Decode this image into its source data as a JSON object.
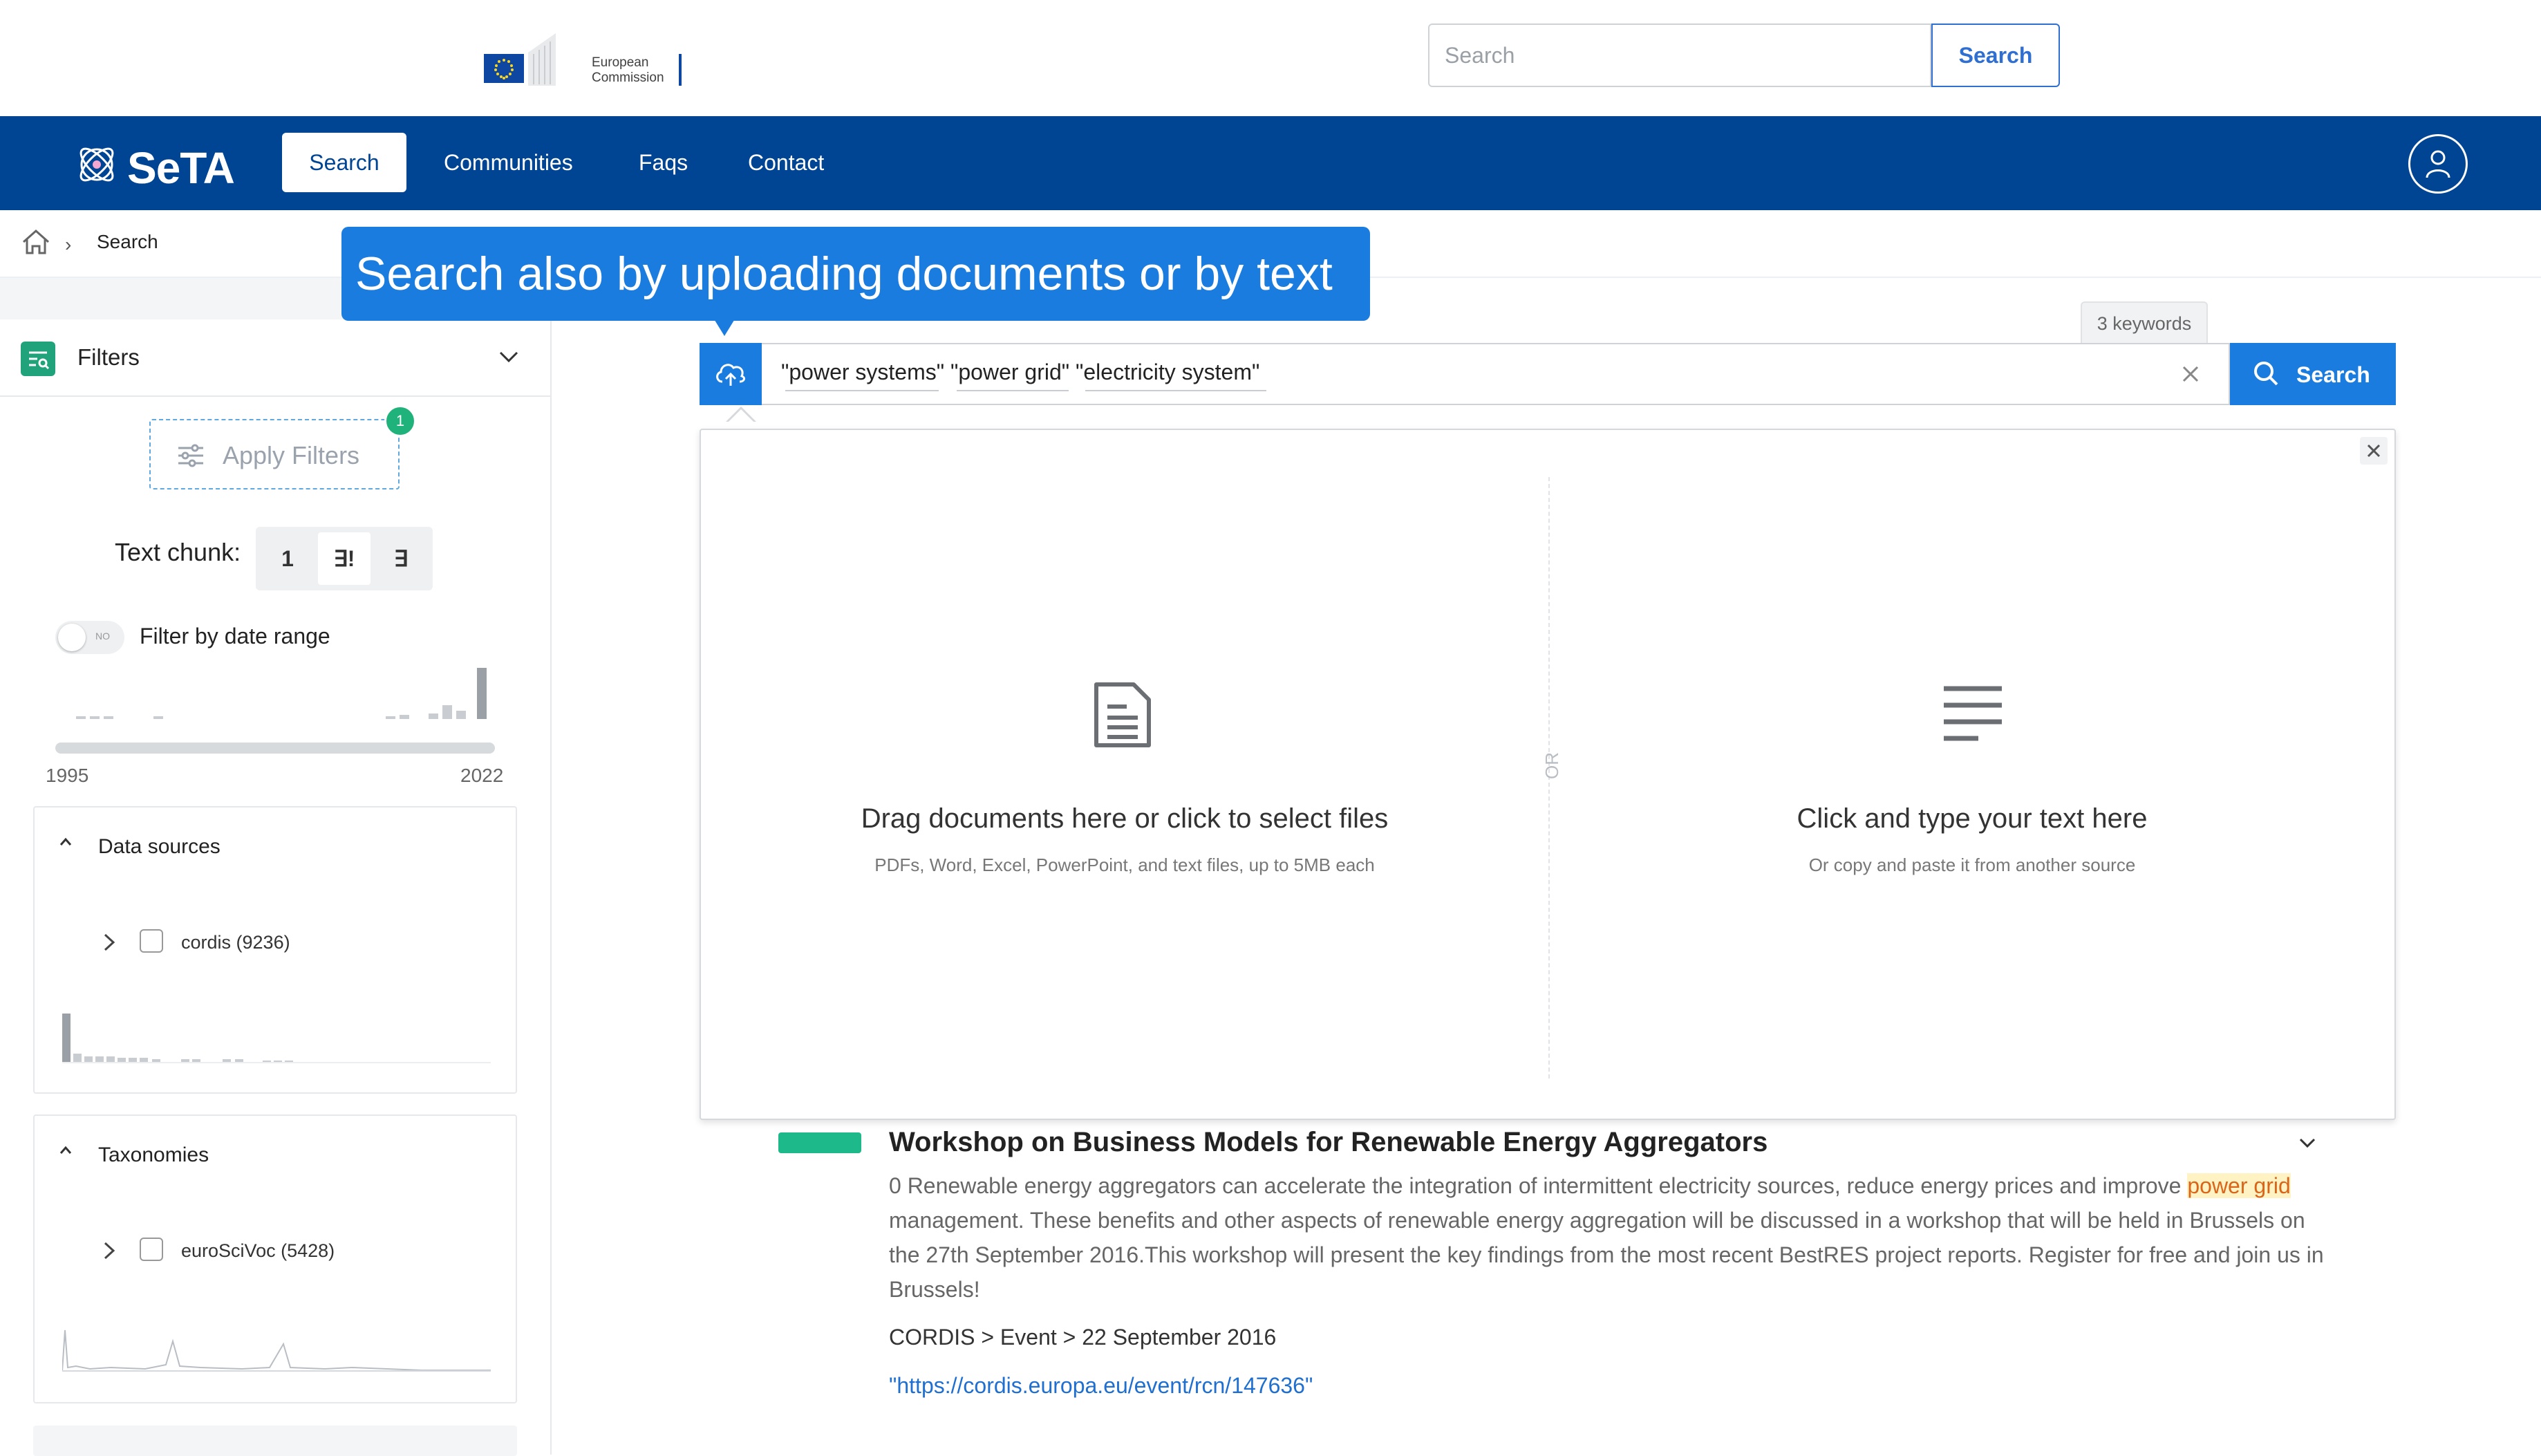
{
  "header": {
    "ec_logo_text_line1": "European",
    "ec_logo_text_line2": "Commission",
    "search_placeholder": "Search",
    "search_button": "Search"
  },
  "nav": {
    "brand": "SeTA",
    "items": [
      {
        "label": "Search",
        "active": true
      },
      {
        "label": "Communities"
      },
      {
        "label": "Faqs"
      },
      {
        "label": "Contact"
      }
    ]
  },
  "breadcrumb": {
    "current": "Search"
  },
  "sidebar": {
    "filters_label": "Filters",
    "apply_filters_label": "Apply Filters",
    "apply_filters_badge": "1",
    "text_chunk_label": "Text chunk:",
    "text_chunk_options": [
      "1",
      "∃!",
      "∃"
    ],
    "date_toggle_text": "NO",
    "date_filter_label": "Filter by date range",
    "date_from": "1995",
    "date_to": "2022",
    "data_sources": {
      "title": "Data sources",
      "items": [
        {
          "label": "cordis (9236)",
          "checked": false
        }
      ]
    },
    "taxonomies": {
      "title": "Taxonomies",
      "items": [
        {
          "label": "euroSciVoc (5428)",
          "checked": false
        }
      ]
    }
  },
  "main": {
    "tooltip": "Search also by uploading documents or by text",
    "keywords_count": "3 keywords",
    "query": "\"power systems\"  \"power grid\"  \"electricity system\"",
    "search_button": "Search",
    "upload_panel": {
      "or_text": "OR",
      "drop_title": "Drag documents here or click to select files",
      "drop_subtitle": "PDFs, Word, Excel, PowerPoint, and text files, up to 5MB each",
      "type_title": "Click and type your text here",
      "type_subtitle": "Or copy and paste it from another source"
    },
    "result": {
      "title": "Workshop on Business Models for Renewable Energy Aggregators",
      "body_before": "0 Renewable energy aggregators can accelerate the integration of intermittent electricity sources, reduce energy prices and improve ",
      "body_highlight": "power grid",
      "body_after": " management. These benefits and other aspects of renewable energy aggregation will be discussed in a workshop that will be held in Brussels on the 27th September 2016.This workshop will present the key findings from the most recent BestRES project reports. Register for free and join us in Brussels!",
      "meta": "CORDIS > Event > 22 September 2016",
      "link": "\"https://cordis.europa.eu/event/rcn/147636\""
    }
  },
  "colors": {
    "nav_bg": "#004494",
    "accent": "#1b7ce0",
    "success": "#1db98a",
    "highlight_bg": "#fff3c4",
    "highlight_text": "#d9651a"
  }
}
